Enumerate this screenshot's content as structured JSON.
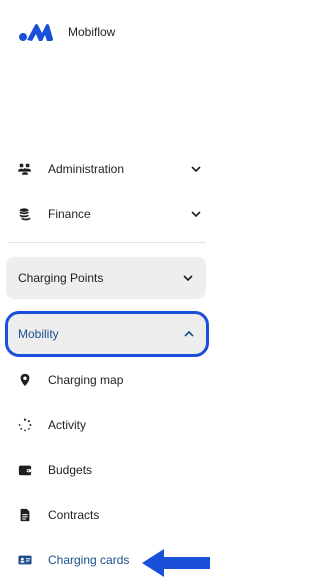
{
  "brand": {
    "name": "Mobiflow"
  },
  "nav": {
    "administration": "Administration",
    "finance": "Finance"
  },
  "sections": {
    "charging_points": "Charging Points",
    "mobility": "Mobility"
  },
  "mobility_items": [
    {
      "label": "Charging map",
      "icon": "location-pin-icon"
    },
    {
      "label": "Activity",
      "icon": "spinner-icon"
    },
    {
      "label": "Budgets",
      "icon": "wallet-icon"
    },
    {
      "label": "Contracts",
      "icon": "document-icon"
    },
    {
      "label": "Charging cards",
      "icon": "id-card-icon"
    }
  ],
  "colors": {
    "accent": "#1c4f8e",
    "highlight": "#1a4fd8",
    "section_bg": "#eeeeee",
    "arrow": "#1a4fd8"
  }
}
